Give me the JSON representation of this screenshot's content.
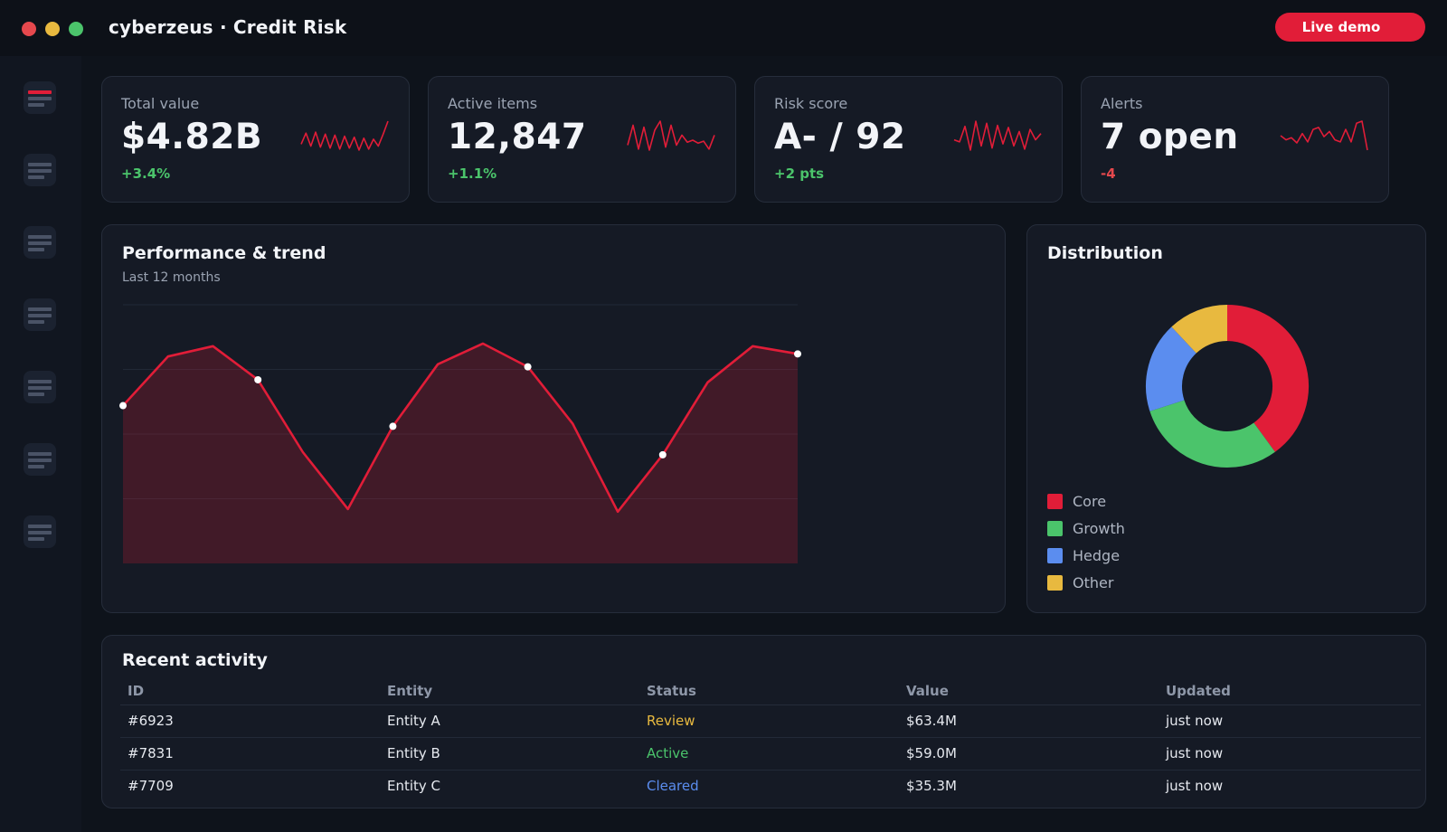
{
  "window": {
    "title": "cyberzeus · Credit Risk",
    "controls": {
      "close_color": "#e5484d",
      "minimize_color": "#e8b93f",
      "maximize_color": "#4bc46b"
    },
    "live_demo_label": "Live demo"
  },
  "colors": {
    "accent": "#e11d38",
    "positive": "#4bc46b",
    "negative": "#e5484d",
    "warning": "#e8b93f",
    "info": "#5b8def"
  },
  "sidebar": {
    "items": [
      {
        "icon": "menu-icon",
        "active": true
      },
      {
        "icon": "menu-icon",
        "active": false
      },
      {
        "icon": "menu-icon",
        "active": false
      },
      {
        "icon": "menu-icon",
        "active": false
      },
      {
        "icon": "menu-icon",
        "active": false
      },
      {
        "icon": "menu-icon",
        "active": false
      },
      {
        "icon": "menu-icon",
        "active": false
      }
    ]
  },
  "kpis": [
    {
      "label": "Total value",
      "value": "$4.82B",
      "delta": "+3.4%",
      "trend": "up",
      "sparkline": [
        7,
        18,
        5,
        19,
        4,
        17,
        3,
        16,
        2,
        15,
        3,
        14,
        1,
        13,
        2,
        12,
        5,
        17,
        30
      ]
    },
    {
      "label": "Active items",
      "value": "12,847",
      "delta": "+1.1%",
      "trend": "up",
      "sparkline": [
        10,
        30,
        6,
        28,
        5,
        25,
        34,
        8,
        30,
        10,
        20,
        13,
        15,
        12,
        14,
        6,
        20
      ]
    },
    {
      "label": "Risk score",
      "value": "A- / 92",
      "delta": "+2 pts",
      "trend": "up",
      "sparkline": [
        12,
        10,
        25,
        2,
        30,
        6,
        28,
        4,
        26,
        8,
        24,
        6,
        20,
        3,
        22,
        12,
        18
      ]
    },
    {
      "label": "Alerts",
      "value": "7 open",
      "delta": "-4",
      "trend": "down",
      "sparkline": [
        18,
        14,
        16,
        11,
        20,
        12,
        24,
        26,
        17,
        22,
        14,
        12,
        24,
        12,
        30,
        32,
        4
      ]
    }
  ],
  "performance": {
    "title": "Performance & trend",
    "subtitle": "Last 12 months"
  },
  "chart_data": [
    {
      "type": "area",
      "title": "Performance & trend",
      "subtitle": "Last 12 months",
      "x": [
        0,
        1,
        2,
        3,
        4,
        5,
        6,
        7,
        8,
        9,
        10,
        11,
        12,
        13,
        14,
        15
      ],
      "series": [
        {
          "values": [
            61,
            80,
            84,
            71,
            43,
            21,
            53,
            77,
            85,
            76,
            54,
            20,
            42,
            70,
            84,
            81
          ]
        }
      ],
      "markers_at": [
        0,
        3,
        6,
        9,
        12,
        15
      ],
      "ylim": [
        0,
        100
      ],
      "grid": true,
      "color": "#e11d38"
    },
    {
      "type": "pie",
      "title": "Distribution",
      "donut": true,
      "categories": [
        "Core",
        "Growth",
        "Hedge",
        "Other"
      ],
      "values": [
        40,
        30,
        18,
        12
      ],
      "colors": [
        "#e11d38",
        "#4bc46b",
        "#5b8def",
        "#e8b93f"
      ],
      "legend": "bottom-left"
    }
  ],
  "distribution": {
    "title": "Distribution",
    "legend": [
      "Core",
      "Growth",
      "Hedge",
      "Other"
    ]
  },
  "activity": {
    "title": "Recent activity",
    "columns": [
      "ID",
      "Entity",
      "Status",
      "Value",
      "Updated"
    ],
    "rows": [
      {
        "id": "#6923",
        "entity": "Entity A",
        "status": "Review",
        "status_color": "#e8b93f",
        "value": "$63.4M",
        "updated": "just now"
      },
      {
        "id": "#7831",
        "entity": "Entity B",
        "status": "Active",
        "status_color": "#4bc46b",
        "value": "$59.0M",
        "updated": "just now"
      },
      {
        "id": "#7709",
        "entity": "Entity C",
        "status": "Cleared",
        "status_color": "#5b8def",
        "value": "$35.3M",
        "updated": "just now"
      }
    ]
  }
}
